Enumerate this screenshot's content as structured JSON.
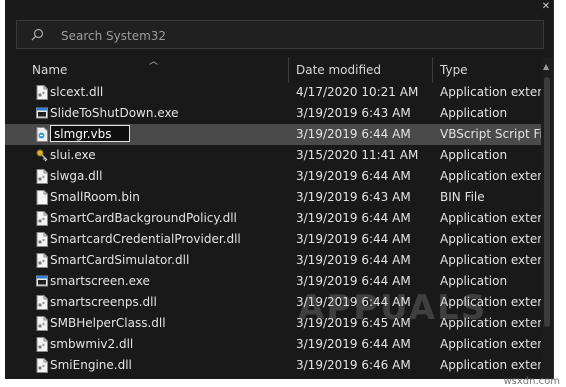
{
  "search": {
    "placeholder": "Search System32"
  },
  "columns": {
    "name": "Name",
    "date": "Date modified",
    "type": "Type"
  },
  "rows": [
    {
      "name": "slcext.dll",
      "date": "4/17/2020 10:21 AM",
      "type": "Application exten...",
      "icon": "dll-file-icon",
      "selected": false
    },
    {
      "name": "SlideToShutDown.exe",
      "date": "3/19/2019 6:43 AM",
      "type": "Application",
      "icon": "exe-file-icon",
      "selected": false
    },
    {
      "name": "slmgr.vbs",
      "date": "3/19/2019 6:44 AM",
      "type": "VBScript Script File",
      "icon": "vbs-script-icon",
      "selected": true
    },
    {
      "name": "slui.exe",
      "date": "3/15/2020 11:41 AM",
      "type": "Application",
      "icon": "key-exe-icon",
      "selected": false
    },
    {
      "name": "slwga.dll",
      "date": "3/19/2019 6:44 AM",
      "type": "Application exten...",
      "icon": "dll-file-icon",
      "selected": false
    },
    {
      "name": "SmallRoom.bin",
      "date": "3/19/2019 6:43 AM",
      "type": "BIN File",
      "icon": "blank-file-icon",
      "selected": false
    },
    {
      "name": "SmartCardBackgroundPolicy.dll",
      "date": "3/19/2019 6:44 AM",
      "type": "Application exten...",
      "icon": "dll-file-icon",
      "selected": false
    },
    {
      "name": "SmartcardCredentialProvider.dll",
      "date": "3/19/2019 6:44 AM",
      "type": "Application exten...",
      "icon": "dll-file-icon",
      "selected": false
    },
    {
      "name": "SmartCardSimulator.dll",
      "date": "3/19/2019 6:44 AM",
      "type": "Application exten...",
      "icon": "dll-file-icon",
      "selected": false
    },
    {
      "name": "smartscreen.exe",
      "date": "3/19/2019 6:44 AM",
      "type": "Application",
      "icon": "exe-file-icon",
      "selected": false
    },
    {
      "name": "smartscreenps.dll",
      "date": "3/19/2019 6:44 AM",
      "type": "Application exten...",
      "icon": "dll-file-icon",
      "selected": false
    },
    {
      "name": "SMBHelperClass.dll",
      "date": "3/19/2019 6:45 AM",
      "type": "Application exten...",
      "icon": "dll-file-icon",
      "selected": false
    },
    {
      "name": "smbwmiv2.dll",
      "date": "3/19/2019 6:44 AM",
      "type": "Application exten...",
      "icon": "dll-file-icon",
      "selected": false
    },
    {
      "name": "SmiEngine.dll",
      "date": "3/19/2019 6:46 AM",
      "type": "Application exten...",
      "icon": "dll-file-icon",
      "selected": false
    }
  ],
  "rename_value": "slmgr.vbs",
  "watermark": "APPUALS",
  "credit": "wsxdn.com",
  "colors": {
    "background": "#191919",
    "selection": "#4a4a4a",
    "text": "#e4e4e4",
    "accent": "#2f7fd6"
  }
}
